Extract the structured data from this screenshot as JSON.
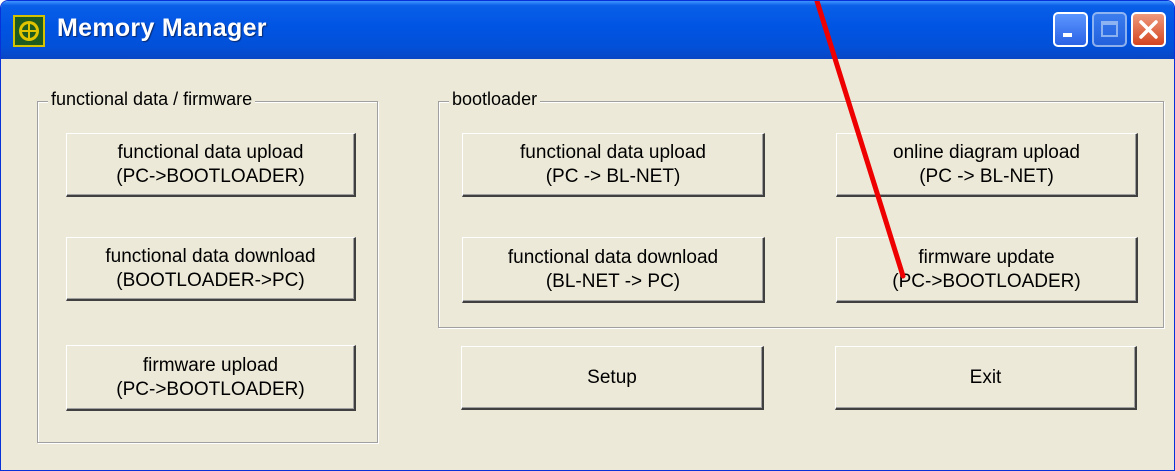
{
  "window": {
    "title": "Memory Manager",
    "icon": "app-icon"
  },
  "groups": {
    "firmware": {
      "label": "functional data / firmware",
      "buttons": [
        {
          "line1": "functional data upload",
          "line2": "(PC->BOOTLOADER)"
        },
        {
          "line1": "functional data download",
          "line2": "(BOOTLOADER->PC)"
        },
        {
          "line1": "firmware upload",
          "line2": "(PC->BOOTLOADER)"
        }
      ]
    },
    "bootloader": {
      "label": "bootloader",
      "buttons": [
        {
          "line1": "functional data upload",
          "line2": "(PC -> BL-NET)"
        },
        {
          "line1": "online diagram upload",
          "line2": "(PC -> BL-NET)"
        },
        {
          "line1": "functional data download",
          "line2": "(BL-NET -> PC)"
        },
        {
          "line1": "firmware update",
          "line2": "(PC->BOOTLOADER)"
        }
      ]
    }
  },
  "actions": {
    "setup": "Setup",
    "exit": "Exit"
  },
  "colors": {
    "titlebar": "#0054e3",
    "face": "#ece9d8",
    "annotation_arrow": "#ee0000"
  }
}
